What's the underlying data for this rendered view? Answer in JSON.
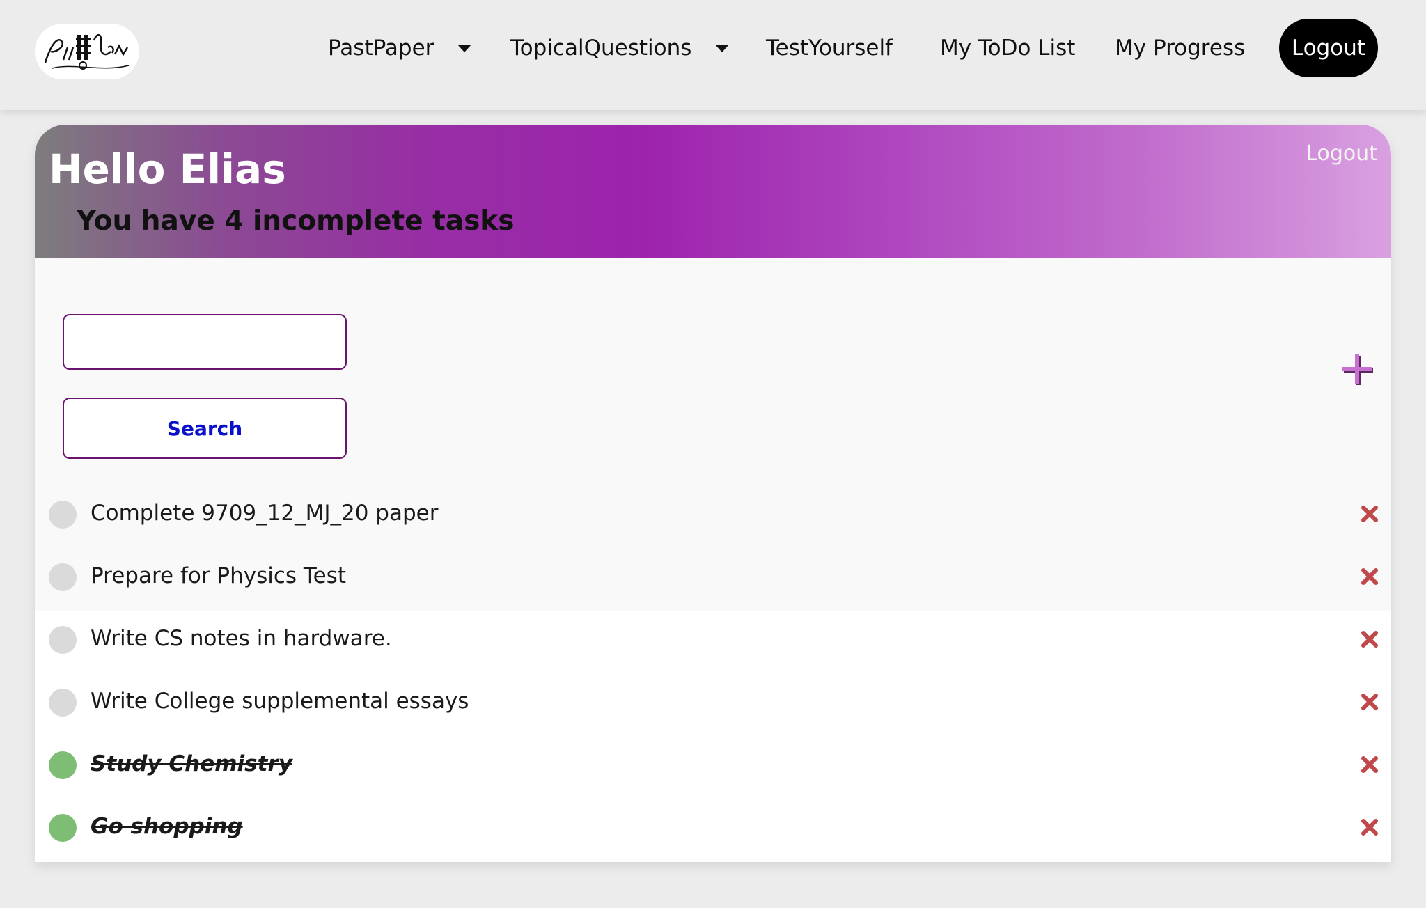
{
  "nav": {
    "items": [
      {
        "label": "PastPaper",
        "has_dropdown": true
      },
      {
        "label": "TopicalQuestions",
        "has_dropdown": true
      },
      {
        "label": "TestYourself",
        "has_dropdown": false
      },
      {
        "label": "My ToDo List",
        "has_dropdown": false
      },
      {
        "label": "My Progress",
        "has_dropdown": false
      }
    ],
    "logout_label": "Logout",
    "logo_icon": "piilearn-logo"
  },
  "header": {
    "greeting": "Hello Elias",
    "subtitle": "You have 4 incomplete tasks",
    "logout_label": "Logout"
  },
  "search": {
    "input_value": "",
    "button_label": "Search"
  },
  "add_icon": "plus-icon",
  "tasks": [
    {
      "text": "Complete 9709_12_MJ_20 paper",
      "completed": false
    },
    {
      "text": "Prepare for Physics Test",
      "completed": false
    },
    {
      "text": "Write CS notes in hardware.",
      "completed": false
    },
    {
      "text": "Write College supplemental essays",
      "completed": false
    },
    {
      "text": "Study Chemistry",
      "completed": true
    },
    {
      "text": "Go shopping",
      "completed": true
    }
  ],
  "colors": {
    "accent_purple": "#9d23ad",
    "search_text": "#0a10c9",
    "delete_red": "#c0474a",
    "done_green": "#7dbd74",
    "pending_gray": "#dadada"
  }
}
